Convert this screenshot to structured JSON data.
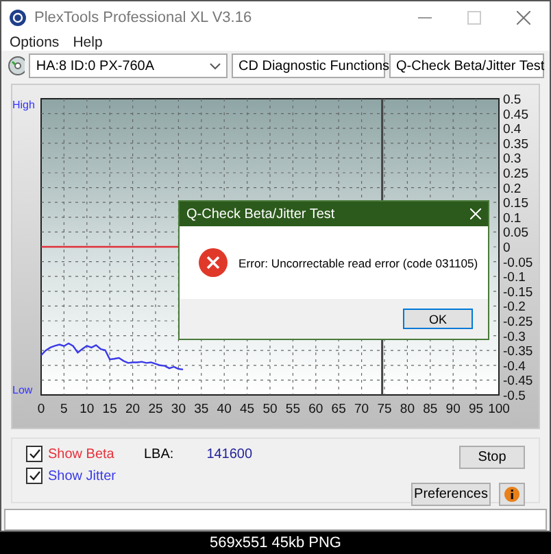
{
  "window": {
    "title": "PlexTools Professional XL V3.16"
  },
  "menu": [
    "Options",
    "Help"
  ],
  "toolbar": [
    {
      "value": "HA:8 ID:0  PX-760A"
    },
    {
      "value": "CD Diagnostic Functions"
    },
    {
      "value": "Q-Check Beta/Jitter Test"
    }
  ],
  "chart": {
    "high_label": "High",
    "low_label": "Low",
    "chart_data": {
      "type": "line",
      "xlim": [
        0,
        100
      ],
      "ylim": [
        -0.5,
        0.5
      ],
      "xticks": [
        0,
        5,
        10,
        15,
        20,
        25,
        30,
        35,
        40,
        45,
        50,
        55,
        60,
        65,
        70,
        75,
        80,
        85,
        90,
        95,
        100
      ],
      "yticks": [
        0.5,
        0.45,
        0.4,
        0.35,
        0.3,
        0.25,
        0.2,
        0.15,
        0.1,
        0.05,
        0,
        -0.05,
        -0.1,
        -0.15,
        -0.2,
        -0.25,
        -0.3,
        -0.35,
        -0.4,
        -0.45,
        -0.5
      ],
      "x": [
        0,
        1,
        2,
        3,
        4,
        5,
        6,
        7,
        8,
        9,
        10,
        11,
        12,
        13,
        14,
        15,
        16,
        17,
        18,
        19,
        20,
        21,
        22,
        23,
        24,
        25,
        26,
        27,
        28,
        29,
        30,
        31
      ],
      "series": [
        {
          "color": "#e0303a",
          "values": [
            0,
            0,
            0,
            0,
            0,
            0,
            0,
            0,
            0,
            0,
            0,
            0,
            0,
            0,
            0,
            0,
            0,
            0,
            0,
            0,
            0,
            0,
            0,
            0,
            0,
            0,
            0,
            0,
            0,
            0,
            0,
            null
          ]
        },
        {
          "color": "#3a3ae8",
          "values": [
            -0.366,
            -0.35,
            -0.34,
            -0.334,
            -0.33,
            -0.335,
            -0.326,
            -0.335,
            -0.357,
            -0.345,
            -0.334,
            -0.34,
            -0.332,
            -0.345,
            -0.349,
            -0.38,
            -0.378,
            -0.375,
            -0.385,
            -0.392,
            -0.39,
            -0.39,
            -0.388,
            -0.392,
            -0.39,
            -0.395,
            -0.4,
            -0.402,
            -0.41,
            -0.405,
            -0.412,
            -0.414
          ]
        }
      ],
      "grid": true,
      "ref_lines": [
        {
          "axis": "x",
          "value": 74.5
        }
      ]
    }
  },
  "options": [
    {
      "label": "Show Beta",
      "checked": true,
      "color": "#e8303a"
    },
    {
      "label": "Show Jitter",
      "checked": true,
      "color": "#3a3ae8"
    }
  ],
  "lba": {
    "label": "LBA:",
    "value": "141600"
  },
  "buttons": {
    "stop": "Stop",
    "preferences": "Preferences"
  },
  "dialog": {
    "title": "Q-Check Beta/Jitter Test",
    "message": "Error: Uncorrectable read error (code 031105)",
    "ok": "OK"
  },
  "caption": "569x551 45kb PNG"
}
